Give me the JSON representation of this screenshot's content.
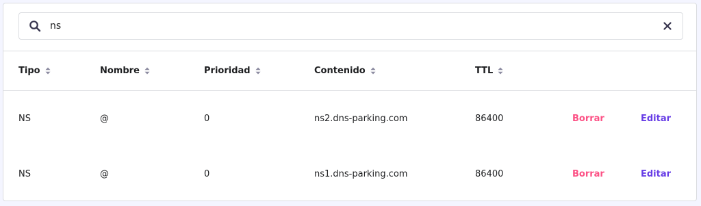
{
  "search": {
    "value": "ns",
    "placeholder": "Buscar"
  },
  "table": {
    "columns": [
      "Tipo",
      "Nombre",
      "Prioridad",
      "Contenido",
      "TTL"
    ],
    "rows": [
      {
        "tipo": "NS",
        "nombre": "@",
        "prioridad": "0",
        "contenido": "ns2.dns-parking.com",
        "ttl": "86400",
        "delete_label": "Borrar",
        "edit_label": "Editar"
      },
      {
        "tipo": "NS",
        "nombre": "@",
        "prioridad": "0",
        "contenido": "ns1.dns-parking.com",
        "ttl": "86400",
        "delete_label": "Borrar",
        "edit_label": "Editar"
      }
    ]
  },
  "colors": {
    "delete": "#fc5185",
    "edit": "#673de6",
    "icon": "#36344d"
  },
  "icons": {
    "search": "search-icon",
    "clear": "close-icon",
    "sort": "sort-icon"
  }
}
